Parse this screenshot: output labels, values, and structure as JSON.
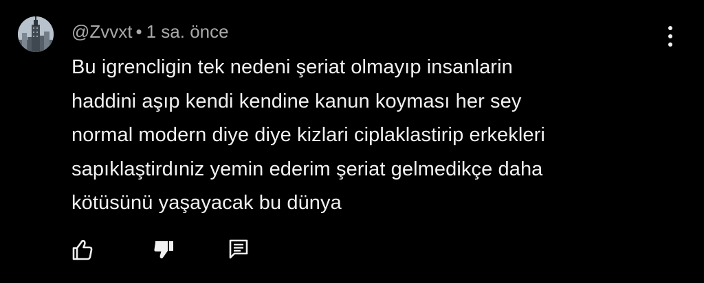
{
  "comment": {
    "author": "@Zvvxt",
    "separator": "•",
    "time": "1 sa. önce",
    "lines": [
      "Bu igrencligin tek nedeni şeriat olmayıp insanlarin",
      "haddini aşıp kendi kendine kanun koyması her sey",
      "normal modern diye diye kizlari ciplaklastirip erkekleri",
      "sapıklaştirdıniz yemin ederim şeriat gelmedikçe daha",
      "kötüsünü yaşayacak bu dünya"
    ]
  },
  "actions": {
    "like_icon": "thumb-up-outline",
    "dislike_icon": "thumb-down-filled",
    "reply_icon": "comment-reply"
  },
  "menu_icon": "more-vertical",
  "colors": {
    "background": "#000000",
    "text": "#f1f1f1",
    "meta": "#aaaaaa"
  }
}
